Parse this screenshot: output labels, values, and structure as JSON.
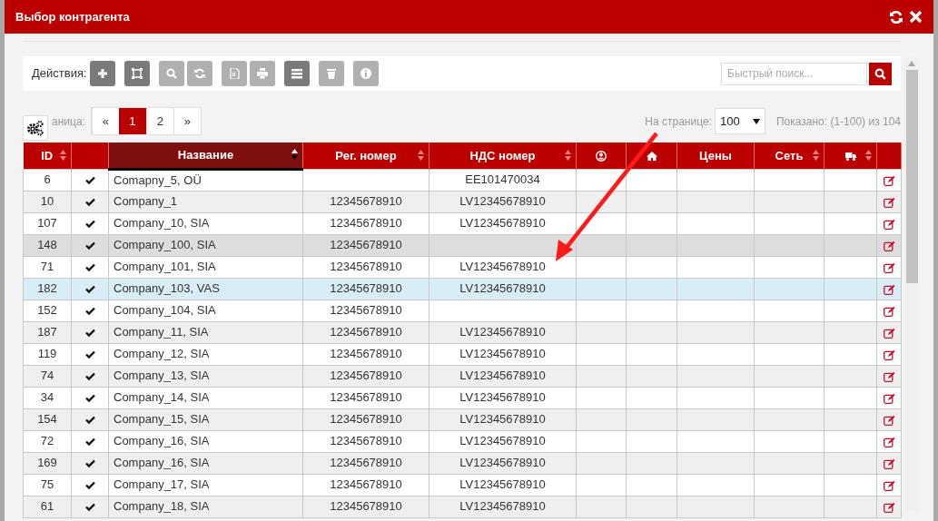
{
  "window": {
    "title": "Выбор контрагента"
  },
  "toolbar": {
    "label": "Действия:",
    "buttons": [
      {
        "disabled": false
      },
      {
        "disabled": false
      },
      {
        "disabled": true
      },
      {
        "disabled": true
      },
      {
        "disabled": true
      },
      {
        "disabled": true
      },
      {
        "disabled": false
      },
      {
        "disabled": true
      },
      {
        "disabled": true
      }
    ],
    "search": {
      "placeholder": "Быстрый поиск..."
    }
  },
  "pagination": {
    "label": "аница:",
    "pages": [
      {
        "label": "«",
        "selected": false
      },
      {
        "label": "1",
        "selected": true
      },
      {
        "label": "2",
        "selected": false
      },
      {
        "label": "»",
        "selected": false
      }
    ],
    "per_page_label": "На странице:",
    "per_page": "100",
    "shown": "Показано: (1-100) из 104"
  },
  "table": {
    "columns": [
      {
        "kind": "text",
        "label": "ID",
        "sortable": true,
        "sorted": false
      },
      {
        "kind": "blank",
        "sortable": false,
        "sorted": false
      },
      {
        "kind": "text",
        "label": "Название",
        "sortable": true,
        "sorted": true
      },
      {
        "kind": "text",
        "label": "Рег. номер",
        "sortable": true,
        "sorted": false
      },
      {
        "kind": "text",
        "label": "НДС номер",
        "sortable": true,
        "sorted": false
      },
      {
        "kind": "icon",
        "sortable": false,
        "sorted": false
      },
      {
        "kind": "icon",
        "sortable": false,
        "sorted": false
      },
      {
        "kind": "text",
        "label": "Цены",
        "sortable": false,
        "sorted": false
      },
      {
        "kind": "text",
        "label": "Сеть",
        "sortable": true,
        "sorted": false
      },
      {
        "kind": "icon",
        "sortable": true,
        "sorted": false
      },
      {
        "kind": "blank",
        "sortable": false,
        "sorted": false
      }
    ],
    "rows": [
      {
        "id": "6",
        "active": true,
        "name": "Comapny_5, OÜ",
        "vat": "EE101470034",
        "selected": false,
        "hovered": false
      },
      {
        "id": "10",
        "active": true,
        "name": "Company_1",
        "reg": "12345678910",
        "vat": "LV12345678910",
        "selected": false,
        "hovered": false
      },
      {
        "id": "107",
        "active": true,
        "name": "Company_10, SIA",
        "reg": "12345678910",
        "vat": "LV12345678910",
        "selected": false,
        "hovered": false
      },
      {
        "id": "148",
        "active": true,
        "name": "Company_100, SIA",
        "reg": "12345678910",
        "selected": false,
        "hovered": true
      },
      {
        "id": "71",
        "active": true,
        "name": "Company_101, SIA",
        "reg": "12345678910",
        "vat": "LV12345678910",
        "selected": false,
        "hovered": false
      },
      {
        "id": "182",
        "active": true,
        "name": "Company_103, VAS",
        "reg": "12345678910",
        "vat": "LV12345678910",
        "selected": true,
        "hovered": false
      },
      {
        "id": "152",
        "active": true,
        "name": "Company_104, SIA",
        "reg": "12345678910",
        "selected": false,
        "hovered": false
      },
      {
        "id": "187",
        "active": true,
        "name": "Company_11, SIA",
        "reg": "12345678910",
        "vat": "LV12345678910",
        "selected": false,
        "hovered": false
      },
      {
        "id": "119",
        "active": true,
        "name": "Company_12, SIA",
        "reg": "12345678910",
        "vat": "LV12345678910",
        "selected": false,
        "hovered": false
      },
      {
        "id": "74",
        "active": true,
        "name": "Company_13, SIA",
        "reg": "12345678910",
        "vat": "LV12345678910",
        "selected": false,
        "hovered": false
      },
      {
        "id": "34",
        "active": true,
        "name": "Company_14, SIA",
        "reg": "12345678910",
        "vat": "LV12345678910",
        "selected": false,
        "hovered": false
      },
      {
        "id": "154",
        "active": true,
        "name": "Company_15, SIA",
        "reg": "12345678910",
        "vat": "LV12345678910",
        "selected": false,
        "hovered": false
      },
      {
        "id": "72",
        "active": true,
        "name": "Company_16, SIA",
        "reg": "12345678910",
        "vat": "LV12345678910",
        "selected": false,
        "hovered": false
      },
      {
        "id": "169",
        "active": true,
        "name": "Company_16, SIA",
        "reg": "12345678910",
        "vat": "LV12345678910",
        "selected": false,
        "hovered": false
      },
      {
        "id": "75",
        "active": true,
        "name": "Company_17, SIA",
        "reg": "12345678910",
        "vat": "LV12345678910",
        "selected": false,
        "hovered": false
      },
      {
        "id": "61",
        "active": true,
        "name": "Company_18, SIA",
        "reg": "12345678910",
        "vat": "LV12345678910",
        "selected": false,
        "hovered": false
      }
    ]
  }
}
